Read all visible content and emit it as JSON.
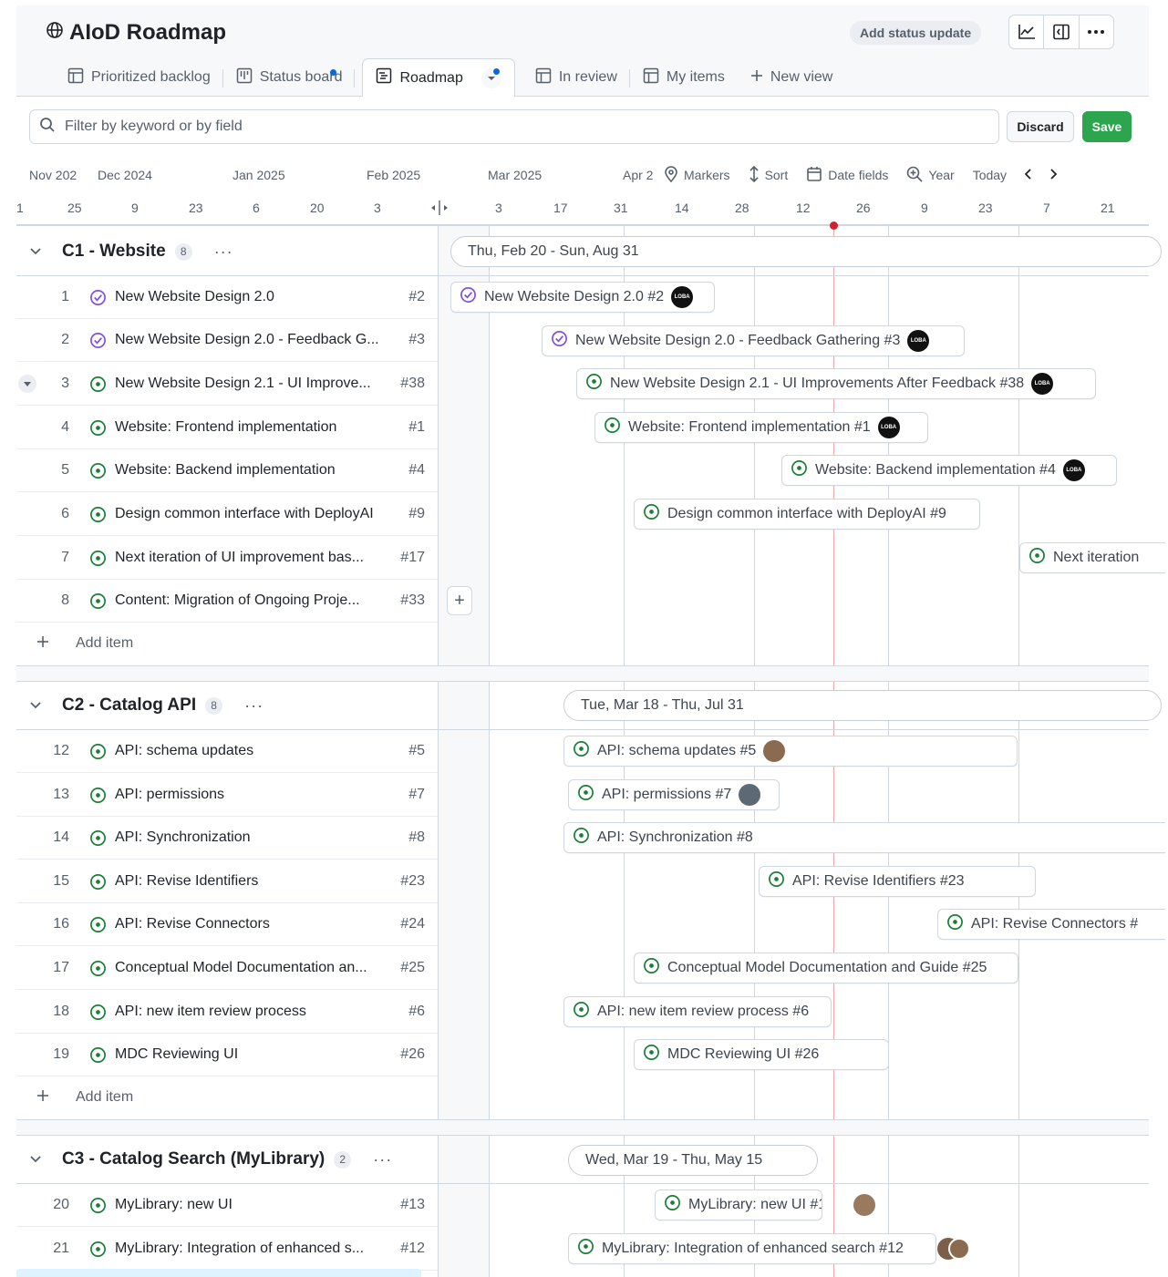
{
  "header": {
    "title": "AIoD Roadmap",
    "add_status": "Add status update"
  },
  "tabs": [
    {
      "label": "Prioritized backlog",
      "icon": "table-icon"
    },
    {
      "label": "Status board",
      "icon": "board-icon"
    },
    {
      "label": "Roadmap",
      "icon": "roadmap-icon"
    },
    {
      "label": "In review",
      "icon": "table-icon"
    },
    {
      "label": "My items",
      "icon": "table-icon"
    },
    {
      "label": "New view",
      "icon": "plus-icon"
    }
  ],
  "filter": {
    "placeholder": "Filter by keyword or by field"
  },
  "actions": {
    "discard": "Discard",
    "save": "Save"
  },
  "timeline": {
    "months": [
      "Nov 202",
      "Dec 2024",
      "Jan 2025",
      "Feb 2025",
      "Mar 2025",
      "Apr 2"
    ],
    "ticks": [
      "1",
      "25",
      "9",
      "23",
      "6",
      "20",
      "3",
      "3",
      "17",
      "31",
      "14",
      "28",
      "12",
      "26",
      "9",
      "23",
      "7",
      "21"
    ],
    "tools": {
      "markers": "Markers",
      "sort": "Sort",
      "date_fields": "Date fields",
      "zoom": "Year",
      "today": "Today"
    }
  },
  "groups": [
    {
      "name": "C1 - Website",
      "count": "8",
      "range": "Thu, Feb 20 - Sun, Aug 31",
      "add": "Add item",
      "items": [
        {
          "n": "1",
          "label": "New Website Design 2.0",
          "issue": "#2",
          "bar": "New Website Design 2.0 #2",
          "status": "done",
          "avatar": "LOBA"
        },
        {
          "n": "2",
          "label": "New Website Design 2.0 - Feedback G...",
          "issue": "#3",
          "bar": "New Website Design 2.0 - Feedback Gathering #3",
          "status": "done",
          "avatar": "LOBA"
        },
        {
          "n": "3",
          "label": "New Website Design 2.1 - UI Improve...",
          "issue": "#38",
          "bar": "New Website Design 2.1 - UI Improvements After Feedback #38",
          "status": "open",
          "avatar": "LOBA"
        },
        {
          "n": "4",
          "label": "Website: Frontend implementation",
          "issue": "#1",
          "bar": "Website: Frontend implementation #1",
          "status": "open",
          "avatar": "LOBA"
        },
        {
          "n": "5",
          "label": "Website: Backend implementation",
          "issue": "#4",
          "bar": "Website: Backend implementation #4",
          "status": "open",
          "avatar": "LOBA"
        },
        {
          "n": "6",
          "label": "Design common interface with DeployAI",
          "issue": "#9",
          "bar": "Design common interface with DeployAI #9",
          "status": "open",
          "avatar": ""
        },
        {
          "n": "7",
          "label": "Next iteration of UI improvement bas...",
          "issue": "#17",
          "bar": "Next iteration",
          "status": "open",
          "avatar": ""
        },
        {
          "n": "8",
          "label": "Content: Migration of Ongoing Proje...",
          "issue": "#33",
          "bar": "",
          "status": "open",
          "avatar": ""
        }
      ]
    },
    {
      "name": "C2 - Catalog API",
      "count": "8",
      "range": "Tue, Mar 18 - Thu, Jul 31",
      "add": "Add item",
      "items": [
        {
          "n": "12",
          "label": "API: schema updates",
          "issue": "#5",
          "bar": "API: schema updates #5",
          "status": "open",
          "avatar": "p1"
        },
        {
          "n": "13",
          "label": "API: permissions",
          "issue": "#7",
          "bar": "API: permissions #7",
          "status": "open",
          "avatar": "p2"
        },
        {
          "n": "14",
          "label": "API: Synchronization",
          "issue": "#8",
          "bar": "API: Synchronization #8",
          "status": "open",
          "avatar": ""
        },
        {
          "n": "15",
          "label": "API: Revise Identifiers",
          "issue": "#23",
          "bar": "API: Revise Identifiers #23",
          "status": "open",
          "avatar": ""
        },
        {
          "n": "16",
          "label": "API: Revise Connectors",
          "issue": "#24",
          "bar": "API: Revise Connectors #",
          "status": "open",
          "avatar": ""
        },
        {
          "n": "17",
          "label": "Conceptual Model Documentation an...",
          "issue": "#25",
          "bar": "Conceptual Model Documentation and Guide #25",
          "status": "open",
          "avatar": ""
        },
        {
          "n": "18",
          "label": "API: new item review process",
          "issue": "#6",
          "bar": "API: new item review process #6",
          "status": "open",
          "avatar": ""
        },
        {
          "n": "19",
          "label": "MDC Reviewing UI",
          "issue": "#26",
          "bar": "MDC Reviewing UI #26",
          "status": "open",
          "avatar": ""
        }
      ]
    },
    {
      "name": "C3 - Catalog Search (MyLibrary)",
      "count": "2",
      "range": "Wed, Mar 19 - Thu, May 15",
      "add": "",
      "items": [
        {
          "n": "20",
          "label": "MyLibrary: new UI",
          "issue": "#13",
          "bar": "MyLibrary: new UI #13",
          "status": "open",
          "avatar": "p3"
        },
        {
          "n": "21",
          "label": "MyLibrary: Integration of enhanced s...",
          "issue": "#12",
          "bar": "MyLibrary: Integration of enhanced search #12",
          "status": "open",
          "avatar": "p4"
        }
      ]
    }
  ],
  "colors": {
    "accent": "#0969da",
    "save": "#2da44e",
    "done": "#8250df",
    "open": "#1a7f37",
    "today": "#cf222e"
  }
}
